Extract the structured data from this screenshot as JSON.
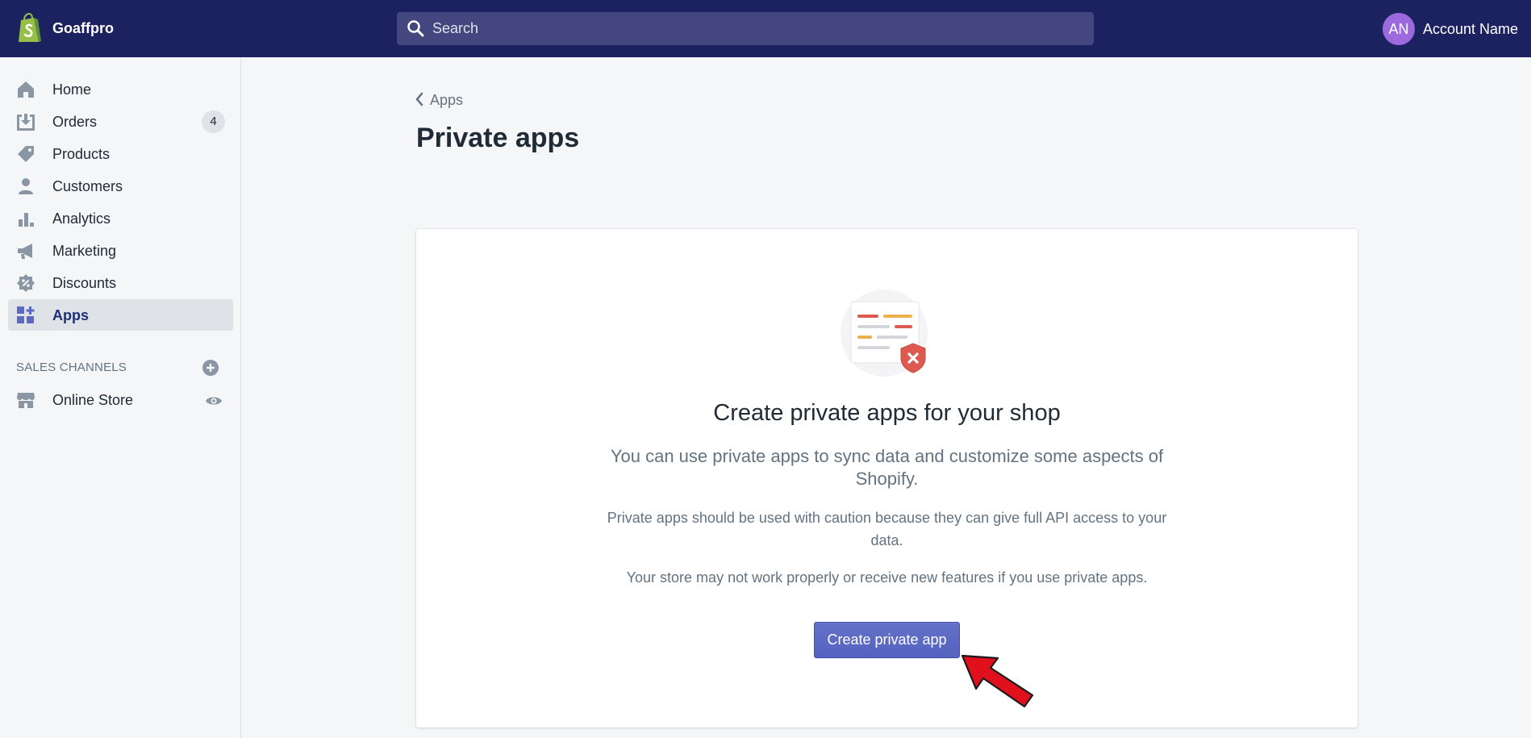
{
  "topbar": {
    "store_name": "Goaffpro",
    "search_placeholder": "Search",
    "avatar_initials": "AN",
    "account_name": "Account Name"
  },
  "sidebar": {
    "items": [
      {
        "label": "Home",
        "icon": "home-icon"
      },
      {
        "label": "Orders",
        "icon": "orders-icon",
        "badge": "4"
      },
      {
        "label": "Products",
        "icon": "tag-icon"
      },
      {
        "label": "Customers",
        "icon": "customer-icon"
      },
      {
        "label": "Analytics",
        "icon": "analytics-icon"
      },
      {
        "label": "Marketing",
        "icon": "megaphone-icon"
      },
      {
        "label": "Discounts",
        "icon": "discount-icon"
      },
      {
        "label": "Apps",
        "icon": "apps-icon",
        "active": true
      }
    ],
    "sales_channels_heading": "SALES CHANNELS",
    "channels": [
      {
        "label": "Online Store",
        "icon": "store-icon"
      }
    ]
  },
  "main": {
    "breadcrumb": "Apps",
    "title": "Private apps",
    "empty_state": {
      "heading": "Create private apps for your shop",
      "subtitle": "You can use private apps to sync data and customize some aspects of Shopify.",
      "caution": "Private apps should be used with caution because they can give full API access to your data.",
      "warning": "Your store may not work properly or receive new features if you use private apps.",
      "button_label": "Create private app"
    }
  },
  "colors": {
    "topbar": "#1c2260",
    "primary": "#5c6ac4",
    "annotation_arrow": "#e0101c"
  }
}
